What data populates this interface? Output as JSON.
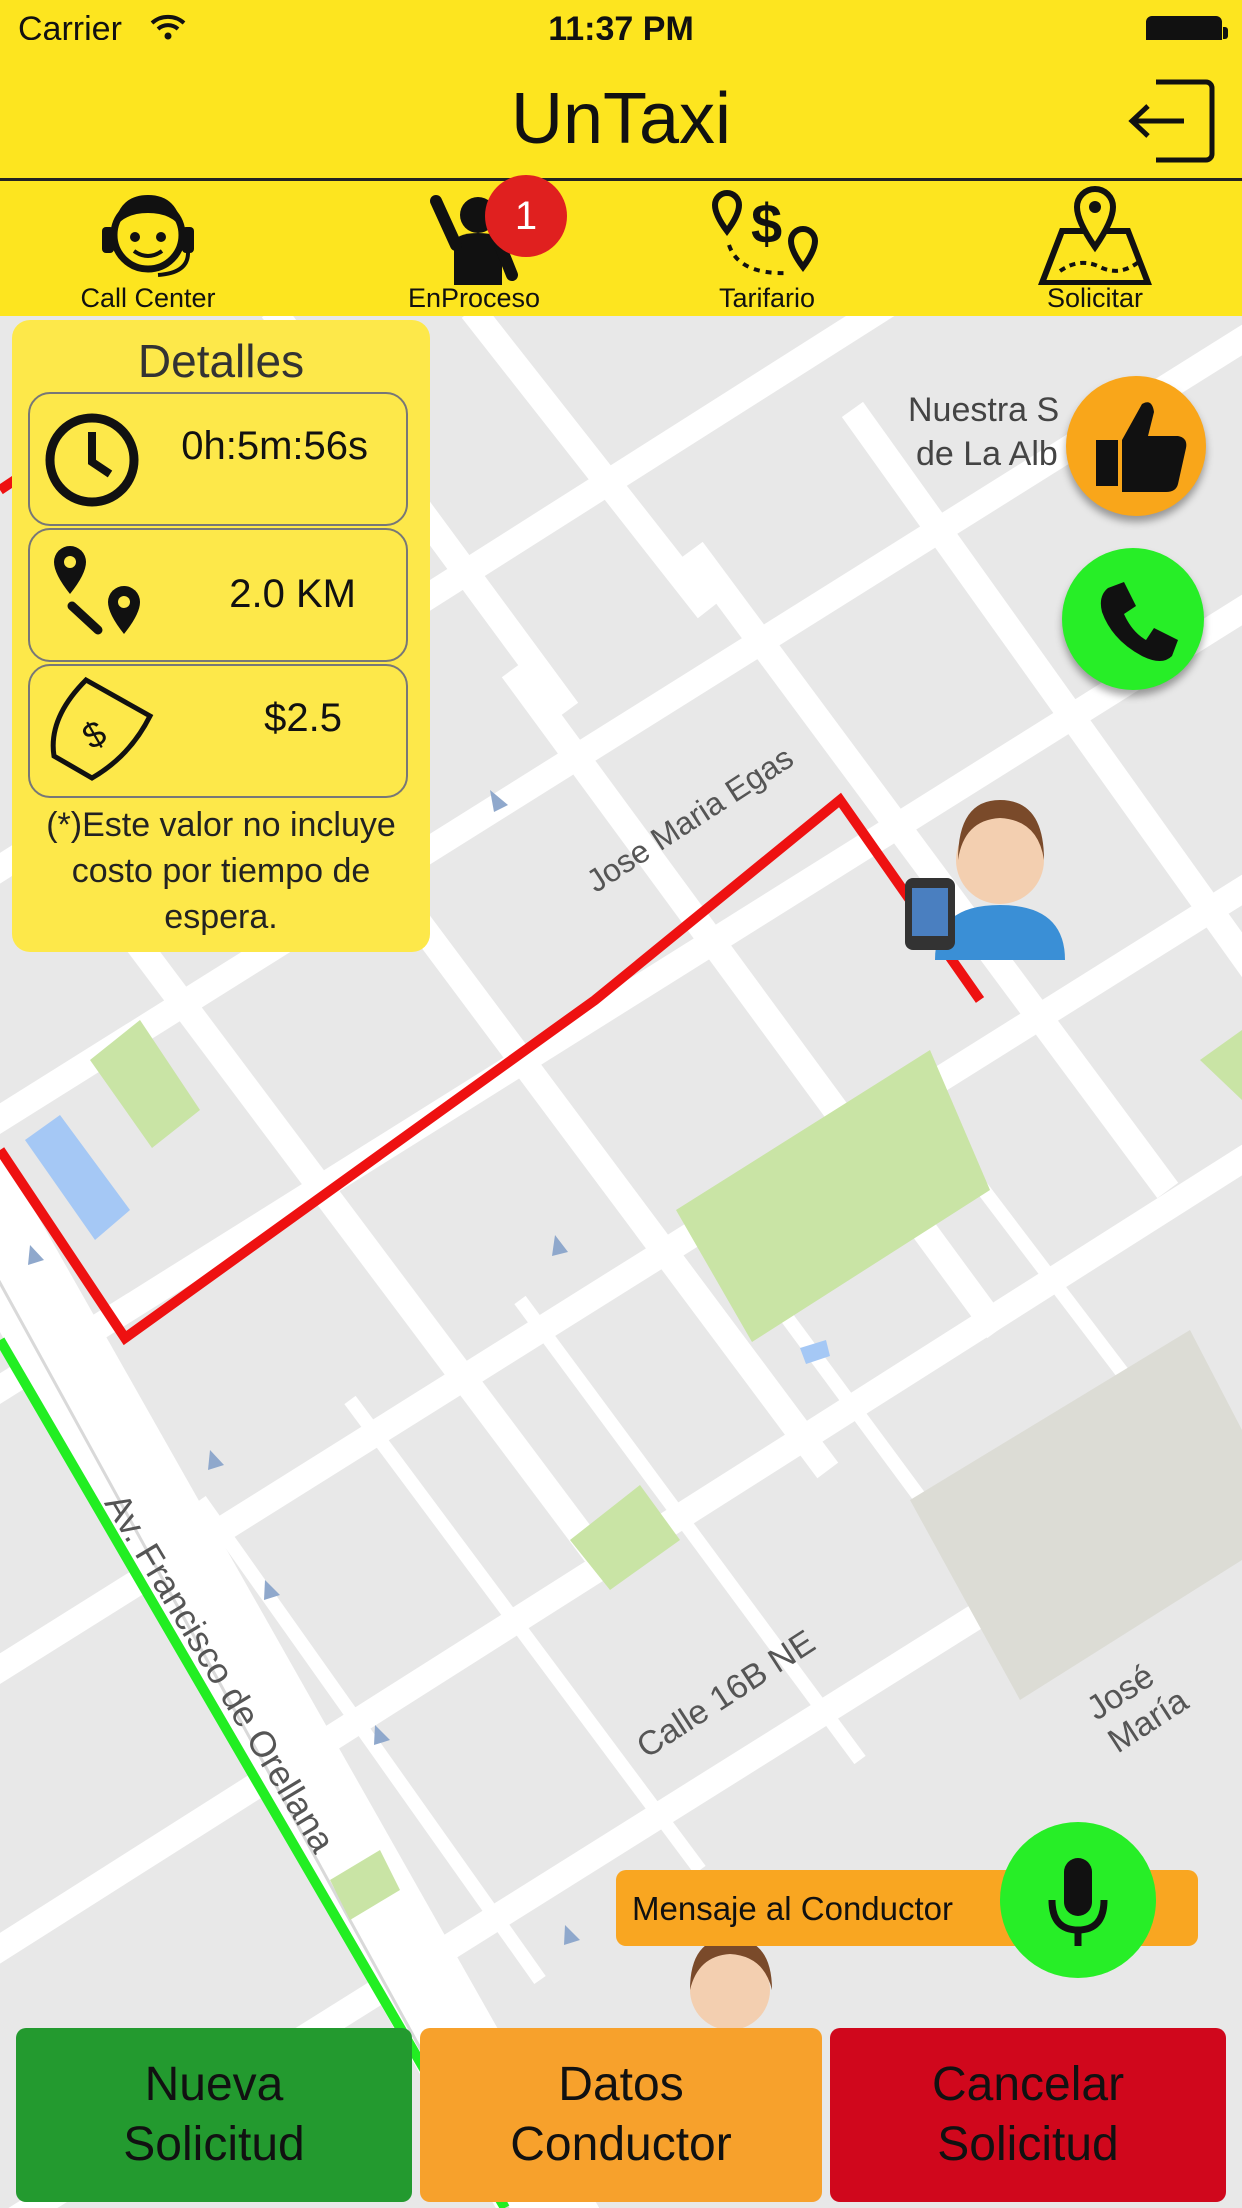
{
  "status_bar": {
    "carrier": "Carrier",
    "time": "11:37 PM"
  },
  "header": {
    "title": "UnTaxi"
  },
  "toolbar": {
    "items": [
      {
        "label": "Call Center",
        "icon": "headset-agent-icon"
      },
      {
        "label": "EnProceso",
        "icon": "waving-person-icon",
        "badge": "1"
      },
      {
        "label": "Tarifario",
        "icon": "fare-route-icon"
      },
      {
        "label": "Solicitar",
        "icon": "map-pin-icon"
      }
    ]
  },
  "details": {
    "title": "Detalles",
    "time": "0h:5m:56s",
    "distance": "2.0 KM",
    "price": "$2.5",
    "note": "(*)Este valor no incluye costo por tiempo de espera."
  },
  "map": {
    "labels": {
      "poi_line1": "Nuestra S",
      "poi_line2": "de La Alb",
      "street1": "Jose Maria Egas",
      "street2": "Av. Francisco de Orellana",
      "street3": "Calle 16B NE",
      "street4": "José María"
    }
  },
  "message": {
    "label": "Mensaje al Conductor"
  },
  "buttons": {
    "new_request": {
      "line1": "Nueva",
      "line2": "Solicitud"
    },
    "driver_data": {
      "line1": "Datos",
      "line2": "Conductor"
    },
    "cancel_request": {
      "line1": "Cancelar",
      "line2": "Solicitud"
    }
  },
  "colors": {
    "brand_yellow": "#fde51f",
    "route_red": "#ee1111",
    "route_green": "#22ee22",
    "green_btn": "#239a2f",
    "orange_btn": "#f7a12c",
    "red_btn": "#d0071c"
  }
}
